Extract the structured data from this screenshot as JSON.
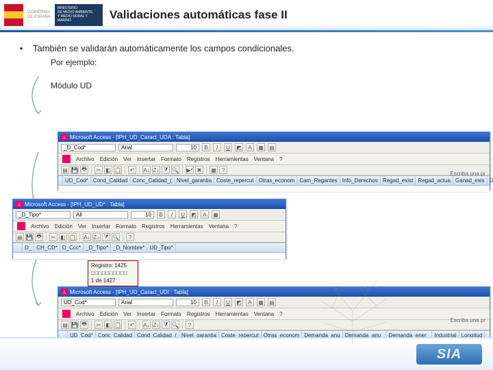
{
  "header": {
    "gov_line1": "GOBIERNO",
    "gov_line2": "DE ESPAÑA",
    "ministry_line1": "MINISTERIO",
    "ministry_line2": "DE MEDIO AMBIENTE",
    "ministry_line3": "Y MEDIO RURAL Y MARINO",
    "title": "Validaciones automáticas fase II"
  },
  "body": {
    "bullet": "•",
    "main_line": "También se validarán automáticamente los campos condicionales.",
    "example": "Por ejemplo:",
    "module": "Módulo UD"
  },
  "access1": {
    "title": "Microsoft Access - [IPH_UD_Caract_UDA : Tabla]",
    "font_field": "_D_Cod*",
    "font_name": "Arial",
    "font_size": "10",
    "menus": [
      "Archivo",
      "Edición",
      "Ver",
      "Insertar",
      "Formato",
      "Registros",
      "Herramientas",
      "Ventana",
      "?"
    ],
    "right_hint": "Escriba una pr",
    "columns": [
      "UD_Cod*",
      "Cond_Calidad",
      "Conc_Calidad_(",
      "Nivel_garantia",
      "Coste_repercut",
      "Otras_econom",
      "Cam_Regantes",
      "Info_Derechos",
      "Regad_exist",
      "Regad_actua",
      "Ganad_exis",
      "Ganad_actua"
    ]
  },
  "access2": {
    "title": "Microsoft Access - [IPH_UD_UD* : Tabla]",
    "font_field": "_D_Tipo*",
    "font_name": "All",
    "font_size": "10",
    "menus": [
      "Archivo",
      "Edición",
      "Ver",
      "Insertar",
      "Formato",
      "Registros",
      "Herramientas",
      "Ventana",
      "?"
    ],
    "columns": [
      "D_",
      "CH_CD*",
      "D_Ccc*",
      "_D_Tipo*",
      "_D_Nombre*",
      "UD_Tipo*"
    ],
    "status_zoom": {
      "l1": "Registro: 1425",
      "l2": "□□□□□□□□□□",
      "l3": "1  de  1427"
    }
  },
  "access3": {
    "title": "Microsoft Access - [IPH_UD_Caract_UDI : Tabla]",
    "font_field": "UD_Cod*",
    "font_name": "Arial",
    "font_size": "10",
    "menus": [
      "Archivo",
      "Edición",
      "Ver",
      "Insertar",
      "Formato",
      "Registros",
      "Herramientas",
      "Ventana",
      "?"
    ],
    "right_hint": "Escriba una pr",
    "columns": [
      "UD_Cod*",
      "Conc_Calidad",
      "Cond_Calidad_(",
      "Nivel_garantia",
      "Coste_repercut",
      "Otras_econom",
      "Demanda_anu",
      "Demanda_anu_",
      "Demanda_ener_",
      "Industrial",
      "Longitud"
    ]
  },
  "footer": {
    "logo": "SIA"
  },
  "colors": {
    "accent_blue": "#1e5aa8",
    "ms_title": "#2a5fbd"
  }
}
